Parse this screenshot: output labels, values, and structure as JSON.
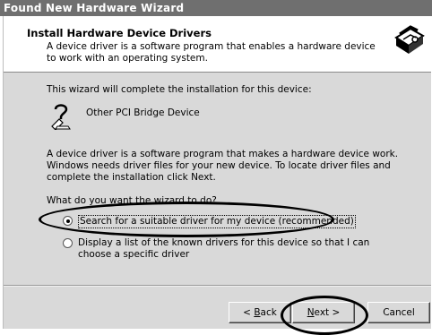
{
  "window": {
    "title": "Found New Hardware Wizard"
  },
  "header": {
    "title": "Install Hardware Device Drivers",
    "subtitle": "A device driver is a software program that enables a hardware device to work with an operating system."
  },
  "content": {
    "intro": "This wizard will complete the installation for this device:",
    "device_name": "Other PCI Bridge Device",
    "explanation": "A device driver is a software program that makes a hardware device work. Windows needs driver files for your new device. To locate driver files and complete the installation click Next.",
    "question": "What do you want the wizard to do?",
    "options": [
      {
        "label": "Search for a suitable driver for my device (recommended)",
        "selected": true
      },
      {
        "label": "Display a list of the known drivers for this device so that I can choose a specific driver",
        "selected": false
      }
    ]
  },
  "buttons": {
    "back": {
      "prefix": "< ",
      "mnemonic": "B",
      "rest": "ack"
    },
    "next": {
      "mnemonic": "N",
      "rest": "ext >"
    },
    "cancel": "Cancel"
  }
}
